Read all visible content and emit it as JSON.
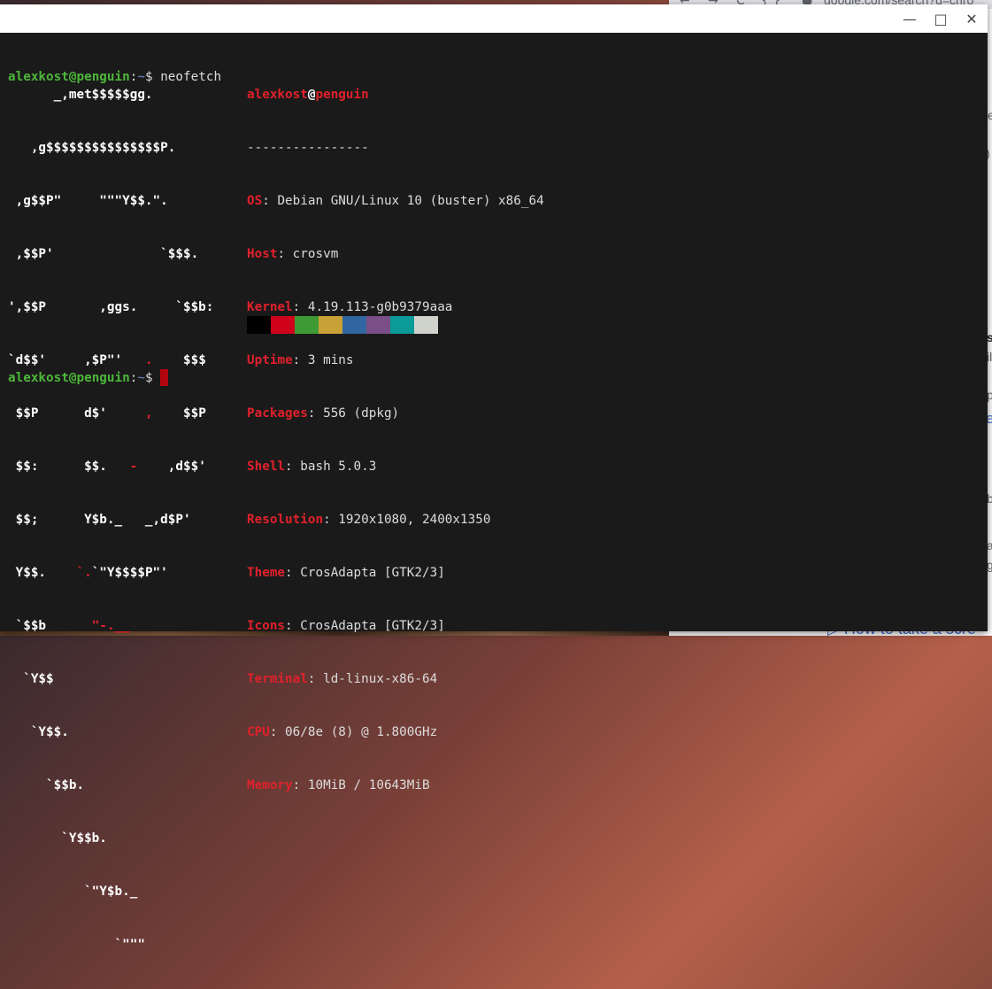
{
  "browser": {
    "url": "google.com/search?q=chro",
    "nav_back": "←",
    "nav_forward": "→",
    "nav_reload": "C",
    "nav_ext": "{ }",
    "link_text": "How to take a scre",
    "fragments": [
      "e",
      ")",
      "s",
      "il",
      "p",
      "e",
      "b",
      "a",
      "g"
    ]
  },
  "window": {
    "minimize": "—",
    "maximize": "□",
    "close": "✕"
  },
  "terminal": {
    "user": "alexkost",
    "at": "@",
    "host": "penguin",
    "path_sep": ":~$ ",
    "path": "~",
    "command": "neofetch",
    "separator": "----------------",
    "logo_lines": [
      "      _,met$$$$$gg.",
      "   ,g$$$$$$$$$$$$$$$P.",
      " ,g$$P\"     \"\"\"Y$$.\".",
      " ,$$P'              `$$$.",
      "',$$P       ,ggs.     `$$b:",
      "`d$$'     ,$P\"'   ",
      " $$P      d$'     ",
      " $$:      $$.   ",
      " $$;      Y$b._   _,d$P'",
      " Y$$.    ",
      " `$$b      ",
      "  `Y$$",
      "   `Y$$.",
      "     `$$b.",
      "       `Y$$b.",
      "          `\"Y$b._",
      "              `\"\"\""
    ],
    "info": [
      {
        "key": "OS",
        "value": "Debian GNU/Linux 10 (buster) x86_64"
      },
      {
        "key": "Host",
        "value": "crosvm"
      },
      {
        "key": "Kernel",
        "value": "4.19.113-g0b9379aaa"
      },
      {
        "key": "Uptime",
        "value": "3 mins"
      },
      {
        "key": "Packages",
        "value": "556 (dpkg)"
      },
      {
        "key": "Shell",
        "value": "bash 5.0.3"
      },
      {
        "key": "Resolution",
        "value": "1920x1080, 2400x1350"
      },
      {
        "key": "Theme",
        "value": "CrosAdapta [GTK2/3]"
      },
      {
        "key": "Icons",
        "value": "CrosAdapta [GTK2/3]"
      },
      {
        "key": "Terminal",
        "value": "ld-linux-x86-64"
      },
      {
        "key": "CPU",
        "value": "06/8e (8) @ 1.800GHz"
      },
      {
        "key": "Memory",
        "value": "10MiB / 10643MiB"
      }
    ],
    "palette": [
      "#000000",
      "#d0021b",
      "#3d9a35",
      "#c8a236",
      "#3266a0",
      "#7a4e86",
      "#0a9a98",
      "#d0d3cc"
    ],
    "cursor_color": "#b3060f"
  },
  "colors": {
    "green": "#4eb63a",
    "red": "#e0212b",
    "blue": "#6c8bd2",
    "bg": "#1a1a1a"
  }
}
